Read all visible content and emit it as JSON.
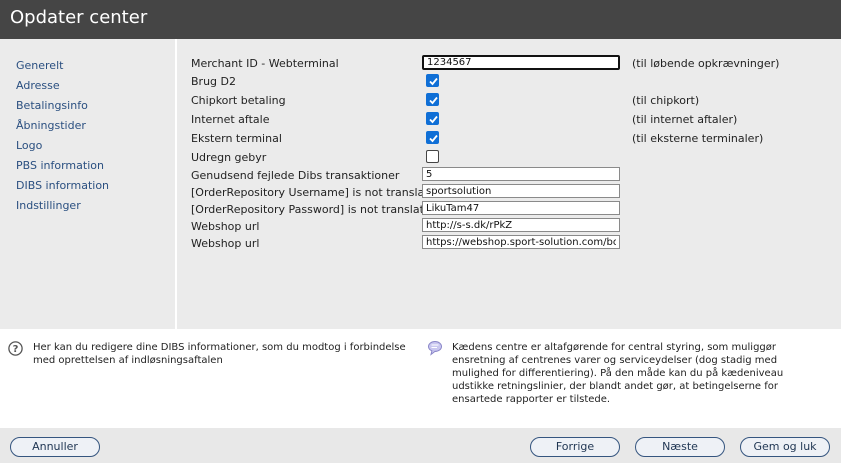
{
  "window": {
    "title": "Opdater center"
  },
  "sidebar": {
    "items": [
      {
        "label": "Generelt"
      },
      {
        "label": "Adresse"
      },
      {
        "label": "Betalingsinfo"
      },
      {
        "label": "Åbningstider"
      },
      {
        "label": "Logo"
      },
      {
        "label": "PBS information"
      },
      {
        "label": "DIBS information"
      },
      {
        "label": "Indstillinger"
      }
    ]
  },
  "form": {
    "merchant_id": {
      "label": "Merchant ID - Webterminal",
      "value": "1234567",
      "note": "(til løbende opkrævninger)"
    },
    "brug_d2": {
      "label": "Brug D2",
      "checked": true
    },
    "chipkort": {
      "label": "Chipkort betaling",
      "checked": true,
      "note": "(til chipkort)"
    },
    "internet": {
      "label": "Internet aftale",
      "checked": true,
      "note": "(til internet aftaler)"
    },
    "ekstern": {
      "label": "Ekstern terminal",
      "checked": true,
      "note": "(til eksterne terminaler)"
    },
    "udregn": {
      "label": "Udregn gebyr",
      "checked": false
    },
    "genudsend": {
      "label": "Genudsend fejlede Dibs transaktioner",
      "value": "5"
    },
    "repo_user": {
      "label": "[OrderRepository Username] is not translated",
      "value": "sportsolution"
    },
    "repo_pass": {
      "label": "[OrderRepository Password] is not translated",
      "value": "LikuTam47"
    },
    "webshop1": {
      "label": "Webshop url",
      "value": "http://s-s.dk/rPkZ"
    },
    "webshop2": {
      "label": "Webshop url",
      "value": "https://webshop.sport-solution.com/boc"
    }
  },
  "help": {
    "left": "Her kan du redigere dine DIBS informationer, som du modtog i forbindelse med oprettelsen af indløsningsaftalen",
    "right": "Kædens centre er altafgørende for central styring, som muliggør ensretning af centrenes varer og serviceydelser (dog stadig med mulighed for differentiering). På den måde kan du på kædeniveau udstikke retningslinier, der blandt andet gør, at betingelserne for ensartede rapporter er tilstede."
  },
  "footer": {
    "cancel": "Annuller",
    "prev": "Forrige",
    "next": "Næste",
    "save_close": "Gem og luk"
  },
  "icons": {
    "help": "question-circle-icon",
    "info": "speech-bubble-icon",
    "checkbox": "checkmark-icon"
  },
  "colors": {
    "titlebar": "#454545",
    "nav_link": "#2a4f80",
    "checkbox_on": "#0f6fd6",
    "panel": "#ebebeb"
  }
}
